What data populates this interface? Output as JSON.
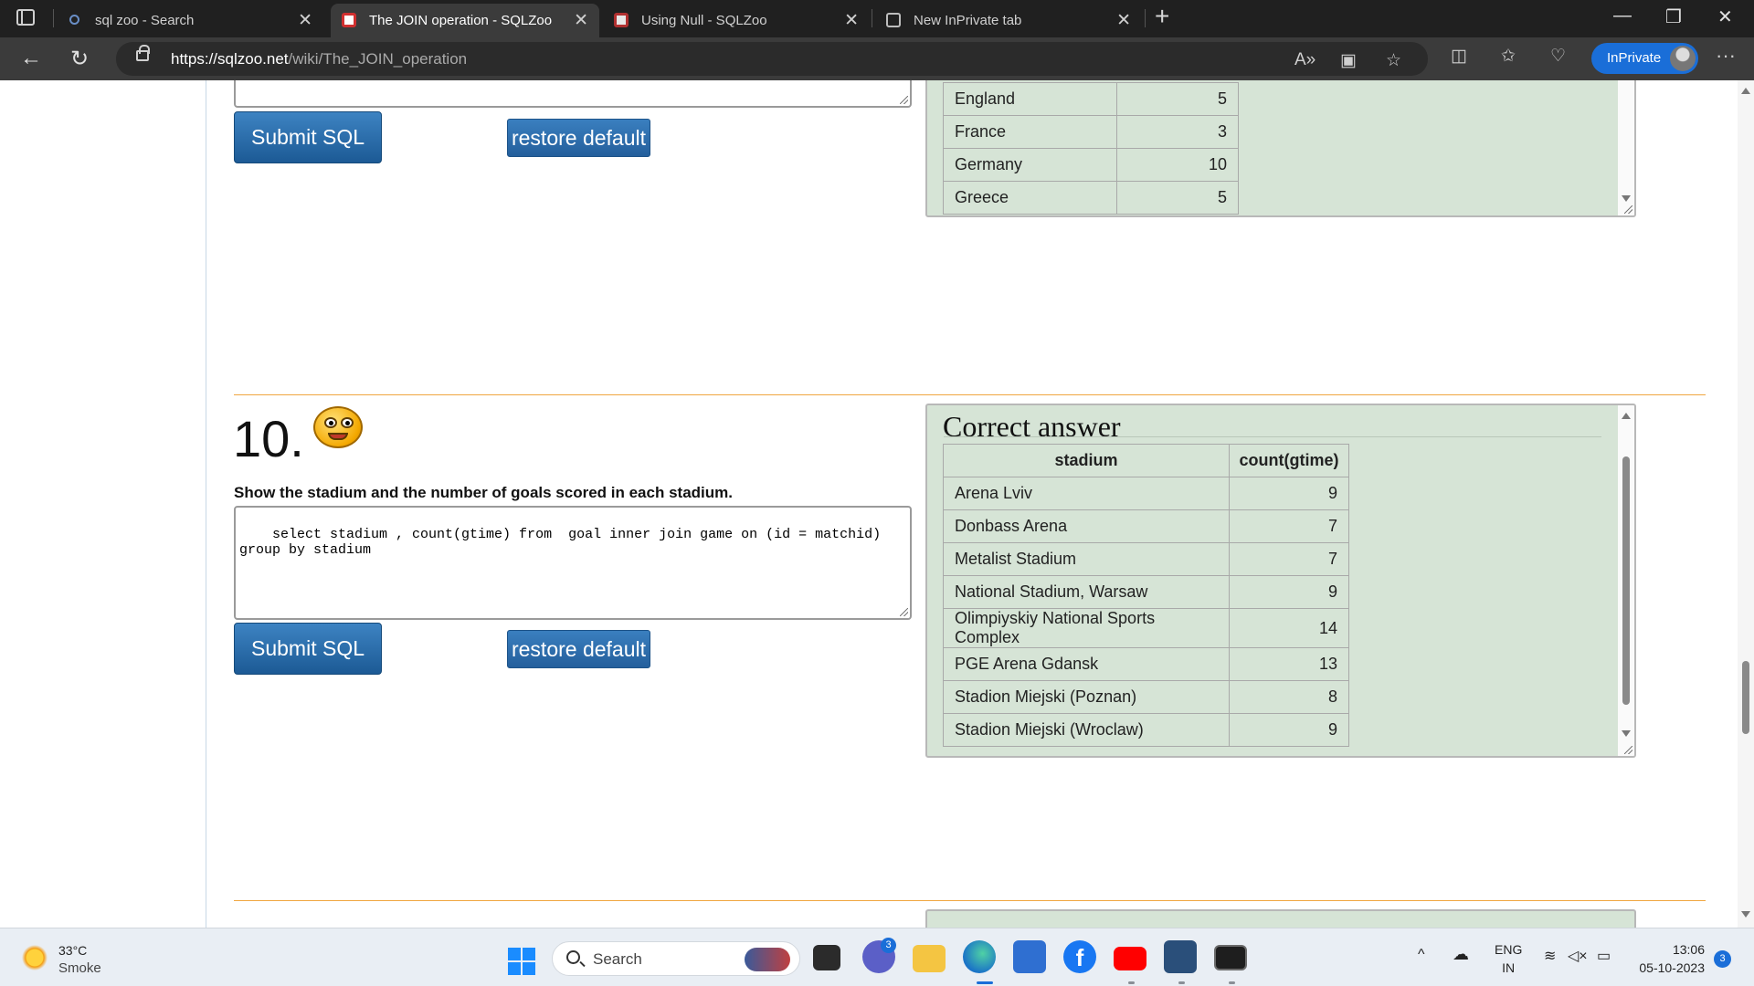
{
  "tabs": [
    {
      "label": "sql zoo - Search",
      "icon": "search-icon"
    },
    {
      "label": "The JOIN operation - SQLZoo",
      "icon": "sqlzoo-icon"
    },
    {
      "label": "Using Null - SQLZoo",
      "icon": "sqlzoo-icon"
    },
    {
      "label": "New InPrivate tab",
      "icon": "inprivate-tab-icon"
    }
  ],
  "address_bar": {
    "url_host": "https://sqlzoo.net",
    "url_path": "/wiki/The_JOIN_operation"
  },
  "inprivate_label": "InPrivate",
  "previous_result": {
    "rows": [
      {
        "name": "England",
        "value": "5"
      },
      {
        "name": "France",
        "value": "3"
      },
      {
        "name": "Germany",
        "value": "10"
      },
      {
        "name": "Greece",
        "value": "5"
      }
    ]
  },
  "buttons": {
    "submit": "Submit SQL",
    "restore": "restore default"
  },
  "question": {
    "number": "10.",
    "text": "Show the stadium and the number of goals scored in each stadium.",
    "sql": "select stadium , count(gtime) from  goal inner join game on (id = matchid)\ngroup by stadium"
  },
  "answer": {
    "title": "Correct answer",
    "columns": [
      "stadium",
      "count(gtime)"
    ],
    "rows": [
      {
        "stadium": "Arena Lviv",
        "count": "9"
      },
      {
        "stadium": "Donbass Arena",
        "count": "7"
      },
      {
        "stadium": "Metalist Stadium",
        "count": "7"
      },
      {
        "stadium": "National Stadium, Warsaw",
        "count": "9"
      },
      {
        "stadium": "Olimpiyskiy National Sports Complex",
        "count": "14"
      },
      {
        "stadium": "PGE Arena Gdansk",
        "count": "13"
      },
      {
        "stadium": "Stadion Miejski (Poznan)",
        "count": "8"
      },
      {
        "stadium": "Stadion Miejski (Wroclaw)",
        "count": "9"
      }
    ]
  },
  "taskbar": {
    "weather_temp": "33°C",
    "weather_desc": "Smoke",
    "search_placeholder": "Search",
    "chat_badge": "3",
    "lang_line1": "ENG",
    "lang_line2": "IN",
    "time": "13:06",
    "date": "05-10-2023",
    "notification_count": "3"
  },
  "colors": {
    "accent": "#1a6ed8",
    "button_blue": "#2a6aa8",
    "answer_bg": "#d6e4d6",
    "separator": "#f0a640"
  }
}
